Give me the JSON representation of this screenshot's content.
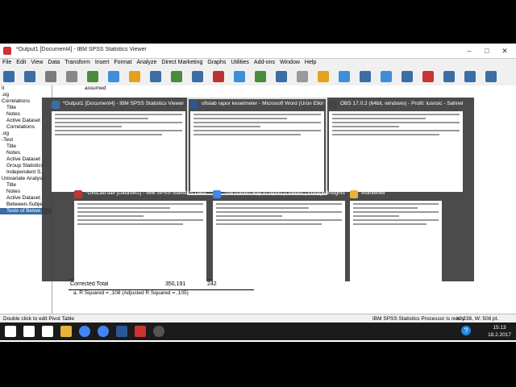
{
  "window": {
    "title": "*Output1 [Document4] - IBM SPSS Statistics Viewer"
  },
  "menu": [
    "File",
    "Edit",
    "View",
    "Data",
    "Transform",
    "Insert",
    "Format",
    "Analyze",
    "Direct Marketing",
    "Graphs",
    "Utilities",
    "Add-ons",
    "Window",
    "Help"
  ],
  "outline": [
    {
      "label": "it",
      "cls": ""
    },
    {
      "label": ".og",
      "cls": ""
    },
    {
      "label": "Correlations",
      "cls": ""
    },
    {
      "label": "Title",
      "cls": "ind"
    },
    {
      "label": "Notes",
      "cls": "ind"
    },
    {
      "label": "Active Dataset",
      "cls": "ind"
    },
    {
      "label": "Correlations",
      "cls": "ind"
    },
    {
      "label": ".og",
      "cls": ""
    },
    {
      "label": "-Test",
      "cls": ""
    },
    {
      "label": "Title",
      "cls": "ind"
    },
    {
      "label": "Notes",
      "cls": "ind"
    },
    {
      "label": "Active Dataset",
      "cls": "ind"
    },
    {
      "label": "Group Statistics",
      "cls": "ind"
    },
    {
      "label": "Independent S...",
      "cls": "ind"
    },
    {
      "label": "Univariate Analysis",
      "cls": ""
    },
    {
      "label": "Title",
      "cls": "ind"
    },
    {
      "label": "Notes",
      "cls": "ind"
    },
    {
      "label": "Active Dataset",
      "cls": "ind"
    },
    {
      "label": "Between-Subje...",
      "cls": "ind"
    },
    {
      "label": "Tests of Betwe...",
      "cls": "ind sel"
    }
  ],
  "content": {
    "assumed": "assumed",
    "corrected_total_label": "Corrected Total",
    "corrected_total_ss": "350,191",
    "corrected_total_df": "242",
    "r_squared_note": "a. R Squared = ,108 (Adjusted R Squared = ,105)"
  },
  "status": {
    "left": "Double click to edit Pivot Table",
    "middle": "IBM SPSS Statistics Processor is ready",
    "right": "H: 238, W: 508 pt."
  },
  "switcher": [
    {
      "title": "*Output1 [Document4] - IBM SPSS Statistics Viewer",
      "icon_color": "#3a6ea5",
      "active": false
    },
    {
      "title": "ofislab rapor kesetmeler - Microsoft Word (Ürün Etkinl...",
      "icon_color": "#2b5797",
      "active": true
    },
    {
      "title": "OBS 17.0.2 (64bit, windows) - Profil: lusnsic - Sahneler...",
      "icon_color": "#444444",
      "active": false
    },
    {
      "title": "*OfisLab.sav [DataSet1] - IBM SPSS Statistics Data Editor",
      "icon_color": "#c33333",
      "active": false
    },
    {
      "title": "The correct way to report p values | Editage Insights -...",
      "icon_color": "#4285f4",
      "active": false
    },
    {
      "title": "İndirilenler",
      "icon_color": "#e8b339",
      "active": false
    }
  ],
  "clock": {
    "time": "15:13",
    "date": "18.2.2017"
  },
  "taskbar_icons": [
    "start-icon",
    "search-icon",
    "task-view-icon",
    "file-explorer-icon",
    "chrome-icon",
    "chrome-icon",
    "word-icon",
    "spss-icon",
    "obs-icon"
  ]
}
